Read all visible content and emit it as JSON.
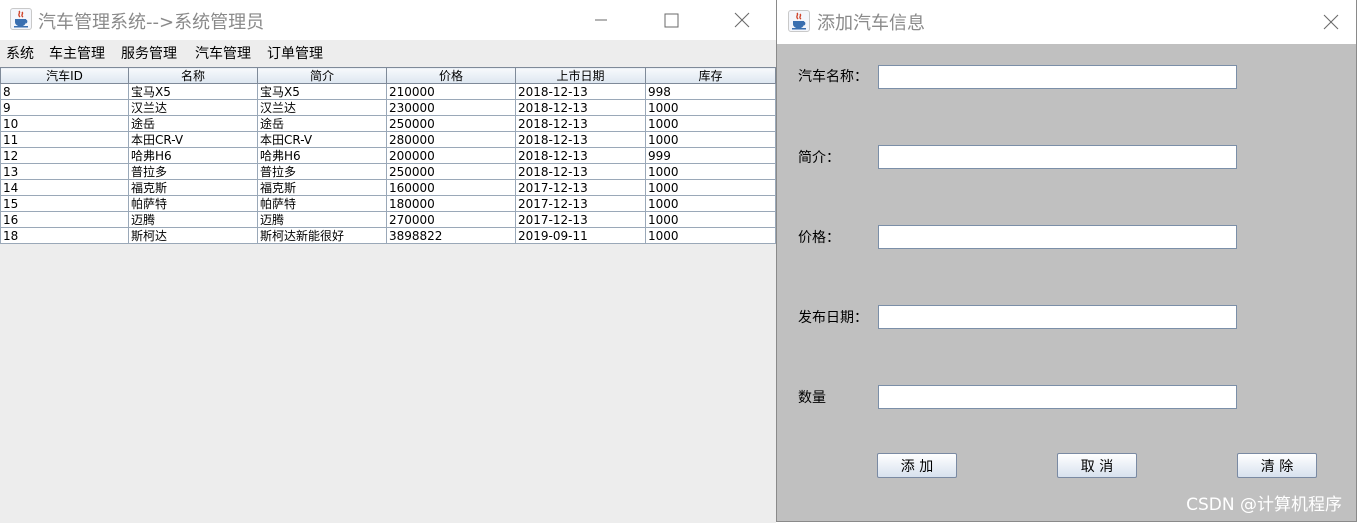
{
  "main_window": {
    "title": "汽车管理系统-->系统管理员",
    "menu": [
      "系统",
      "车主管理",
      "服务管理",
      "汽车管理",
      "订单管理"
    ],
    "table": {
      "columns": [
        "汽车ID",
        "名称",
        "简介",
        "价格",
        "上市日期",
        "库存"
      ],
      "rows": [
        [
          "8",
          "宝马X5",
          "宝马X5",
          "210000",
          "2018-12-13",
          "998"
        ],
        [
          "9",
          "汉兰达",
          "汉兰达",
          "230000",
          "2018-12-13",
          "1000"
        ],
        [
          "10",
          "途岳",
          "途岳",
          "250000",
          "2018-12-13",
          "1000"
        ],
        [
          "11",
          "本田CR-V",
          "本田CR-V",
          "280000",
          "2018-12-13",
          "1000"
        ],
        [
          "12",
          "哈弗H6",
          "哈弗H6",
          "200000",
          "2018-12-13",
          "999"
        ],
        [
          "13",
          "普拉多",
          "普拉多",
          "250000",
          "2018-12-13",
          "1000"
        ],
        [
          "14",
          "福克斯",
          "福克斯",
          "160000",
          "2017-12-13",
          "1000"
        ],
        [
          "15",
          "帕萨特",
          "帕萨特",
          "180000",
          "2017-12-13",
          "1000"
        ],
        [
          "16",
          "迈腾",
          "迈腾",
          "270000",
          "2017-12-13",
          "1000"
        ],
        [
          "18",
          "斯柯达",
          "斯柯达新能很好",
          "3898822",
          "2019-09-11",
          "1000"
        ]
      ]
    }
  },
  "dialog": {
    "title": "添加汽车信息",
    "fields": [
      {
        "label": "汽车名称：",
        "value": ""
      },
      {
        "label": "简介：",
        "value": ""
      },
      {
        "label": "价格：",
        "value": ""
      },
      {
        "label": "发布日期：",
        "value": ""
      },
      {
        "label": "数量",
        "value": ""
      }
    ],
    "buttons": [
      "添 加",
      "取 消",
      "清 除"
    ]
  },
  "watermark": "CSDN @计算机程序",
  "icons": {
    "app": "java-cup-icon",
    "minimize": "minimize-icon",
    "maximize": "maximize-icon",
    "close": "close-icon"
  }
}
